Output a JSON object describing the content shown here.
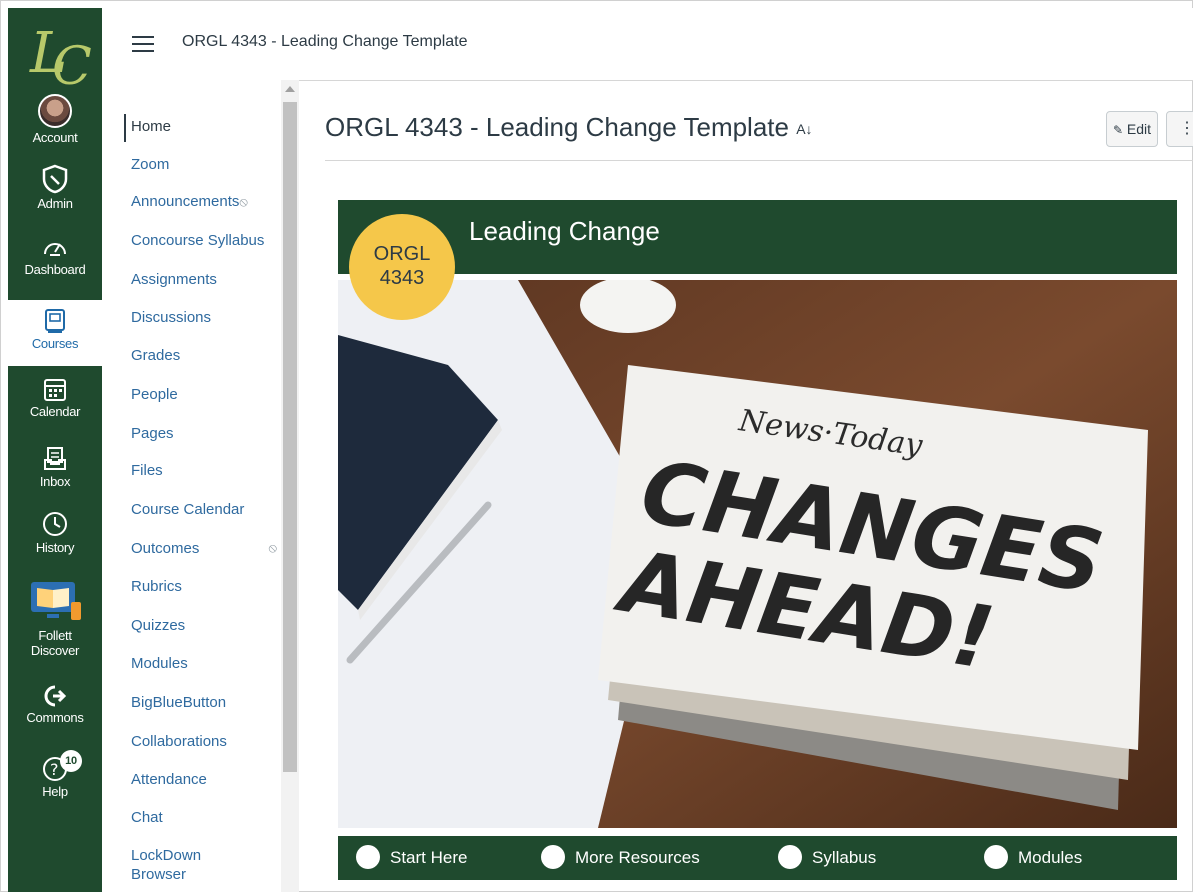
{
  "global_nav": {
    "logo_text": "LC",
    "items": [
      {
        "label": "Account",
        "icon": "avatar"
      },
      {
        "label": "Admin",
        "icon": "shield-icon"
      },
      {
        "label": "Dashboard",
        "icon": "speedometer-icon"
      },
      {
        "label": "Courses",
        "icon": "book-icon"
      },
      {
        "label": "Calendar",
        "icon": "calendar-icon"
      },
      {
        "label": "Inbox",
        "icon": "inbox-icon"
      },
      {
        "label": "History",
        "icon": "clock-icon"
      },
      {
        "label_line1": "Follett",
        "label_line2": "Discover",
        "icon": "follett-book-icon"
      },
      {
        "label": "Commons",
        "icon": "commons-arrow-icon"
      },
      {
        "label": "Help",
        "icon": "help-icon",
        "badge": "10"
      }
    ],
    "colors": {
      "background": "#1f4a2e",
      "active_background": "#ffffff"
    }
  },
  "topbar": {
    "breadcrumb": "ORGL 4343 - Leading Change Template"
  },
  "course_nav": {
    "items": [
      {
        "label": "Home",
        "active": true
      },
      {
        "label": "Zoom"
      },
      {
        "label": "Announcements",
        "hidden_icon": true
      },
      {
        "label": "Concourse Syllabus"
      },
      {
        "label": "Assignments"
      },
      {
        "label": "Discussions"
      },
      {
        "label": "Grades"
      },
      {
        "label": "People"
      },
      {
        "label": "Pages"
      },
      {
        "label": "Files"
      },
      {
        "label": "Course Calendar"
      },
      {
        "label": "Outcomes",
        "hidden_icon": true
      },
      {
        "label": "Rubrics"
      },
      {
        "label": "Quizzes"
      },
      {
        "label": "Modules"
      },
      {
        "label": "BigBlueButton"
      },
      {
        "label": "Collaborations"
      },
      {
        "label": "Attendance"
      },
      {
        "label": "Chat"
      },
      {
        "label_line1": "LockDown",
        "label_line2": "Browser"
      }
    ]
  },
  "main": {
    "title": "ORGL 4343 - Leading Change Template",
    "edit_label": "Edit",
    "more_label": "⋮",
    "banner": {
      "title": "Leading Change",
      "circle_line1": "ORGL",
      "circle_line2": "4343"
    },
    "hero_image": {
      "masthead": "News·Today",
      "headline_line1": "CHANGES",
      "headline_line2": "AHEAD!"
    },
    "link_bar": [
      {
        "label": "Start Here",
        "icon": "arrow-curve-icon"
      },
      {
        "label": "More Resources",
        "icon": "plus-icon"
      },
      {
        "label": "Syllabus",
        "icon": "document-icon"
      },
      {
        "label": "Modules",
        "icon": "modules-icon"
      }
    ],
    "colors": {
      "accent_green": "#1f4a2e",
      "circle_yellow": "#f5c74a",
      "link_blue": "#2f6a9f"
    }
  }
}
